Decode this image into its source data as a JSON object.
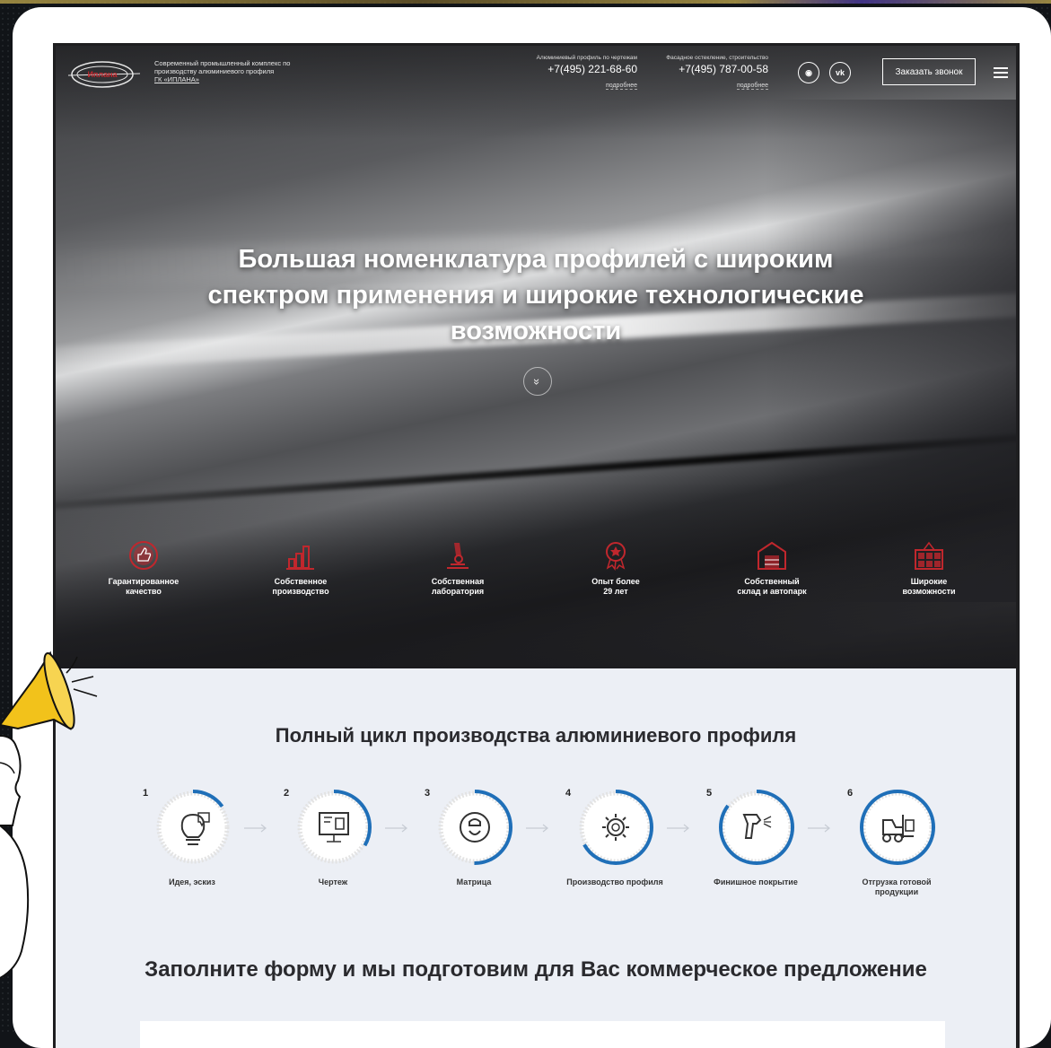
{
  "header": {
    "logo_text": "Иплана",
    "tagline_line1": "Современный промышленный комплекс по",
    "tagline_line2": "производству алюминиевого профиля",
    "tagline_link": "ГК «ИПЛАНА»",
    "phone1_caption": "Алюминиевый профиль по чертежам",
    "phone1": "+7(495) 221-68-60",
    "phone1_more": "подробнее",
    "phone2_caption": "Фасадное остекление, строительство",
    "phone2": "+7(495) 787-00-58",
    "phone2_more": "подробнее",
    "social1": "◉",
    "social2": "vk",
    "callback_label": "Заказать звонок"
  },
  "hero": {
    "title_line1": "Большая номенклатура профилей с широким",
    "title_line2": "спектром применения и широкие технологические",
    "title_line3": "возможности",
    "scroll_glyph": "»"
  },
  "features": [
    {
      "line1": "Гарантированное",
      "line2": "качество"
    },
    {
      "line1": "Собственное",
      "line2": "производство"
    },
    {
      "line1": "Собственная",
      "line2": "лаборатория"
    },
    {
      "line1": "Опыт более",
      "line2": "29 лет"
    },
    {
      "line1": "Собственный",
      "line2": "склад и автопарк"
    },
    {
      "line1": "Широкие",
      "line2": "возможности"
    }
  ],
  "cycle": {
    "title": "Полный цикл производства алюминиевого профиля",
    "steps": [
      {
        "num": "1",
        "label": "Идея, эскиз",
        "label2": ""
      },
      {
        "num": "2",
        "label": "Чертеж",
        "label2": ""
      },
      {
        "num": "3",
        "label": "Матрица",
        "label2": ""
      },
      {
        "num": "4",
        "label": "Производство профиля",
        "label2": ""
      },
      {
        "num": "5",
        "label": "Финишное покрытие",
        "label2": ""
      },
      {
        "num": "6",
        "label": "Отгрузка готовой",
        "label2": "продукции"
      }
    ]
  },
  "form": {
    "title": "Заполните форму и мы подготовим для Вас коммерческое предложение"
  },
  "colors": {
    "accent_red": "#c0272d",
    "accent_blue": "#1f6fb8",
    "light_bg": "#eceff5"
  }
}
